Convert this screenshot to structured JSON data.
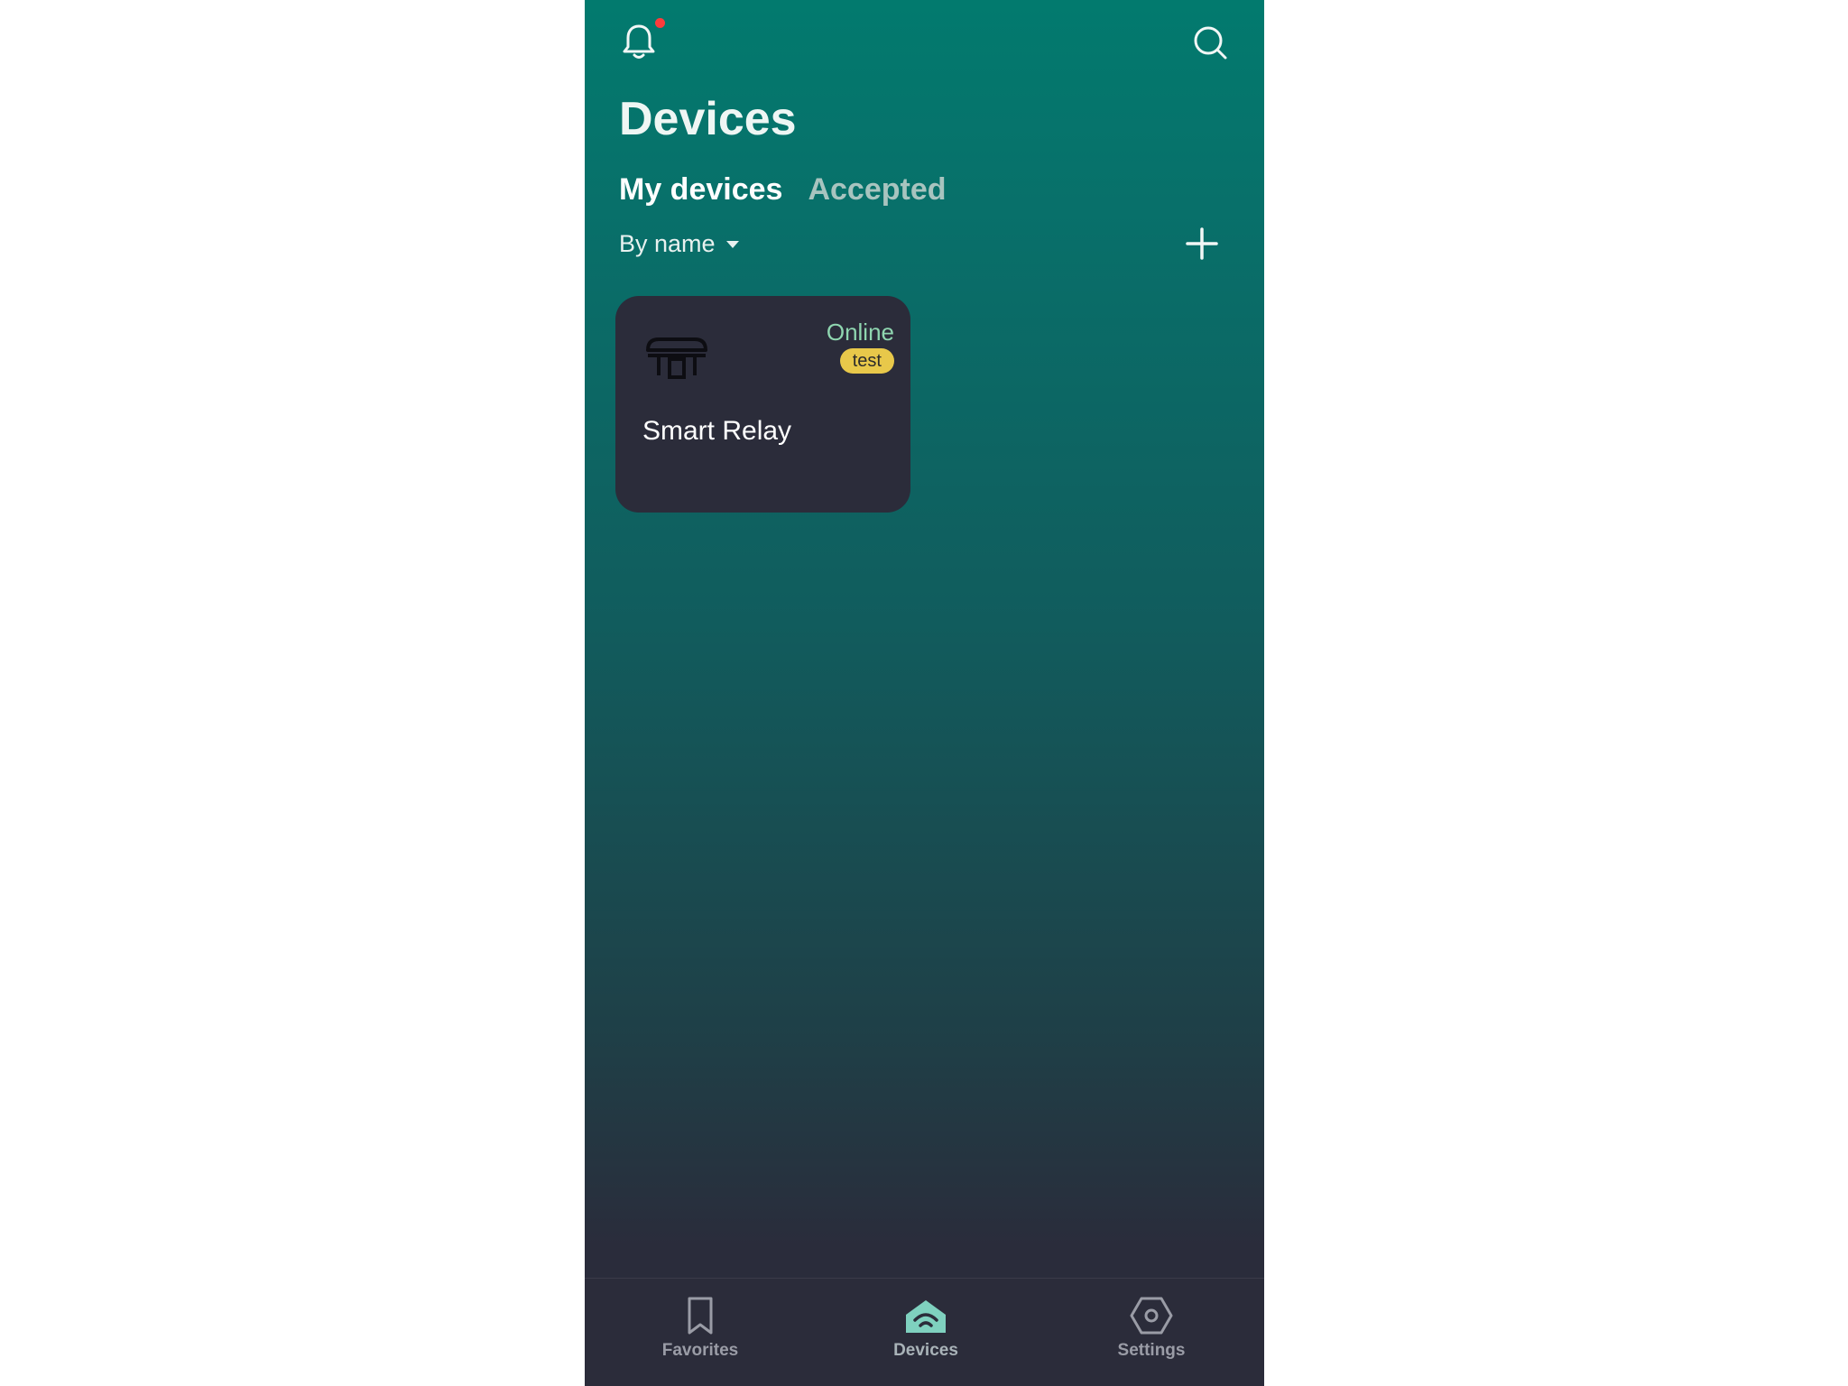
{
  "header": {
    "title": "Devices",
    "bell_badge_color": "#ff3b3b"
  },
  "tabs": [
    {
      "label": "My devices",
      "active": true
    },
    {
      "label": "Accepted",
      "active": false
    }
  ],
  "sort": {
    "label": "By name"
  },
  "devices": [
    {
      "name": "Smart Relay",
      "status": "Online",
      "tag": "test",
      "icon": "relay-icon"
    }
  ],
  "bottom_nav": [
    {
      "label": "Favorites",
      "icon": "bookmark-icon",
      "active": false
    },
    {
      "label": "Devices",
      "icon": "home-wifi-icon",
      "active": true
    },
    {
      "label": "Settings",
      "icon": "hexagon-gear-icon",
      "active": false
    }
  ],
  "colors": {
    "accent": "#7fd1bf",
    "status_online": "#8fd6b0",
    "tag": "#e8c84a",
    "card_bg": "#2b2c3a"
  }
}
